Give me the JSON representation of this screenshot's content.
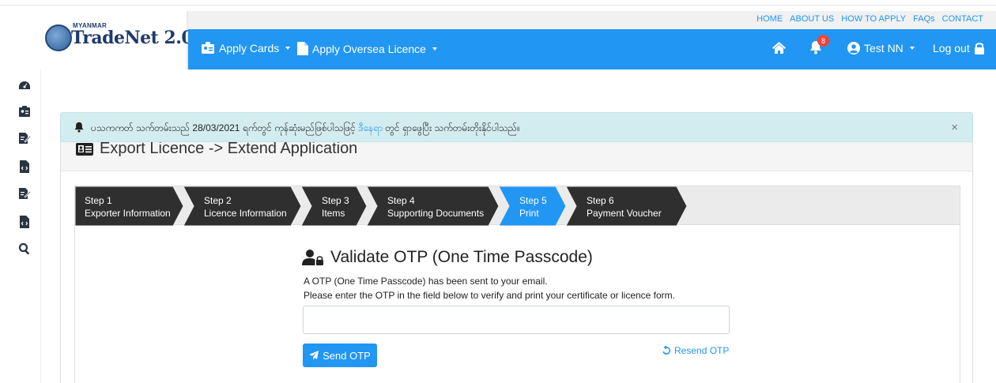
{
  "brand": {
    "small": "MYANMAR",
    "name": "TradeNet 2.0"
  },
  "util_links": [
    "HOME",
    "ABOUT US",
    "HOW TO APPLY",
    "FAQs",
    "CONTACT"
  ],
  "nav": {
    "apply_cards": "Apply Cards",
    "apply_oversea": "Apply Oversea Licence",
    "notification_count": "8",
    "user": "Test NN",
    "logout": "Log out"
  },
  "sidebar_icons": [
    "dashboard-icon",
    "id-card-icon",
    "edit-doc-icon",
    "file-code-icon",
    "edit-doc-icon",
    "file-code-icon",
    "search-icon"
  ],
  "alert": {
    "text_before": "ပသကကတ် သက်တမ်းသည် 28/03/2021 ရက်တွင် ကုန်ဆုံးမည်ဖြစ်ပါသဖြင့် ",
    "link": "ဒီနေရာ",
    "text_after": " တွင် ရှာဖွေပြီး သက်တမ်းတိုးနိုင်ပါသည်။",
    "close": "×"
  },
  "card": {
    "title": "Export Licence -> Extend Application"
  },
  "steps": [
    {
      "num": "Step 1",
      "label": "Exporter Information",
      "active": false
    },
    {
      "num": "Step 2",
      "label": "Licence Information",
      "active": false
    },
    {
      "num": "Step 3",
      "label": "Items",
      "active": false
    },
    {
      "num": "Step 4",
      "label": "Supporting Documents",
      "active": false
    },
    {
      "num": "Step 5",
      "label": "Print",
      "active": true
    },
    {
      "num": "Step 6",
      "label": "Payment Voucher",
      "active": false
    }
  ],
  "otp": {
    "title": "Validate OTP (One Time Passcode)",
    "line1": "A OTP (One Time Passcode) has been sent to your email.",
    "line2": "Please enter the OTP in the field below to verify and print your certificate or licence form.",
    "input_value": "",
    "send_label": "Send OTP",
    "resend_label": "Resend OTP"
  },
  "colors": {
    "primary": "#2196f3",
    "step_dark": "#2f2f2f",
    "alert_bg": "#d3ecf0",
    "badge": "#f44336"
  }
}
